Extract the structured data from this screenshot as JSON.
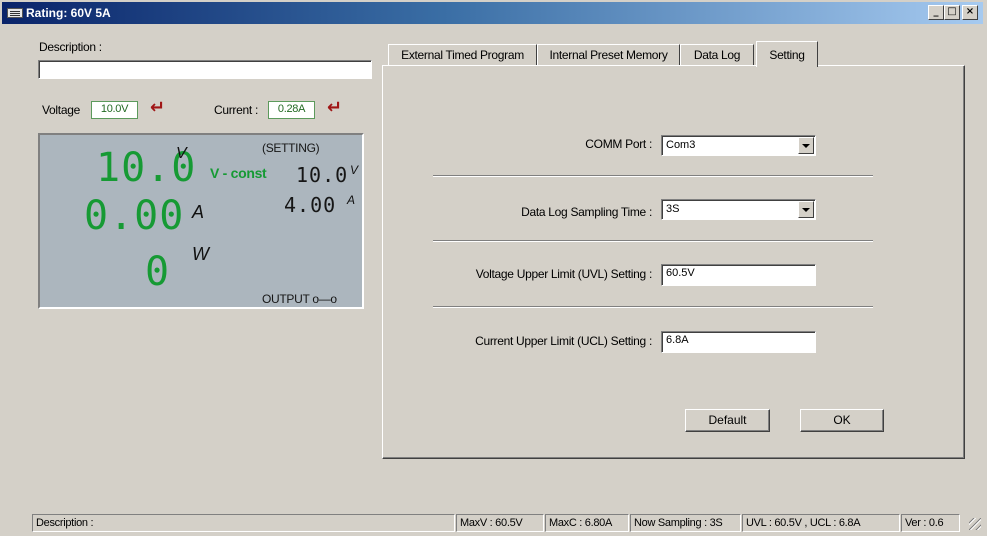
{
  "window": {
    "title": "Rating: 60V 5A",
    "minimize_label": "_",
    "maximize_label": "□",
    "close_label": "×"
  },
  "left": {
    "description_label": "Description :",
    "description_value": "",
    "voltage_label": "Voltage",
    "voltage_value": "10.0V",
    "current_label": "Current :",
    "current_value": "0.28A"
  },
  "display": {
    "volts_value": "10.0",
    "volts_unit": "V",
    "amps_value": "0.00",
    "amps_unit": "A",
    "watts_value": "0",
    "watts_unit": "W",
    "setting_label": "(SETTING)",
    "mode_label": "V - const",
    "set_volts_value": "10.0",
    "set_volts_unit": "V",
    "set_amps_value": "4.00",
    "set_amps_unit": "A",
    "output_label": "OUTPUT o—o"
  },
  "tabs": [
    {
      "label": "External Timed Program"
    },
    {
      "label": "Internal Preset Memory"
    },
    {
      "label": "Data Log"
    },
    {
      "label": "Setting",
      "active": true
    }
  ],
  "settings": {
    "comm_port_label": "COMM Port :",
    "comm_port_value": "Com3",
    "sampling_label": "Data Log Sampling Time :",
    "sampling_value": "3S",
    "uvl_label": "Voltage Upper Limit (UVL) Setting :",
    "uvl_value": "60.5V",
    "ucl_label": "Current Upper Limit (UCL) Setting :",
    "ucl_value": "6.8A",
    "default_button": "Default",
    "ok_button": "OK"
  },
  "statusbar": {
    "description": "Description :",
    "maxv": "MaxV : 60.5V",
    "maxc": "MaxC : 6.80A",
    "sampling": "Now Sampling : 3S",
    "limits": "UVL : 60.5V , UCL : 6.8A",
    "version": "Ver : 0.6"
  },
  "colors": {
    "lcd_background": "#acb6be",
    "segment_green": "#169a34",
    "title_bar": "#0a246a",
    "enter_icon": "#a01616"
  },
  "icons": {
    "app": "app-icon",
    "enter": "enter-arrow-icon",
    "dropdown": "chevron-down-icon",
    "resize": "resize-grip-icon"
  }
}
